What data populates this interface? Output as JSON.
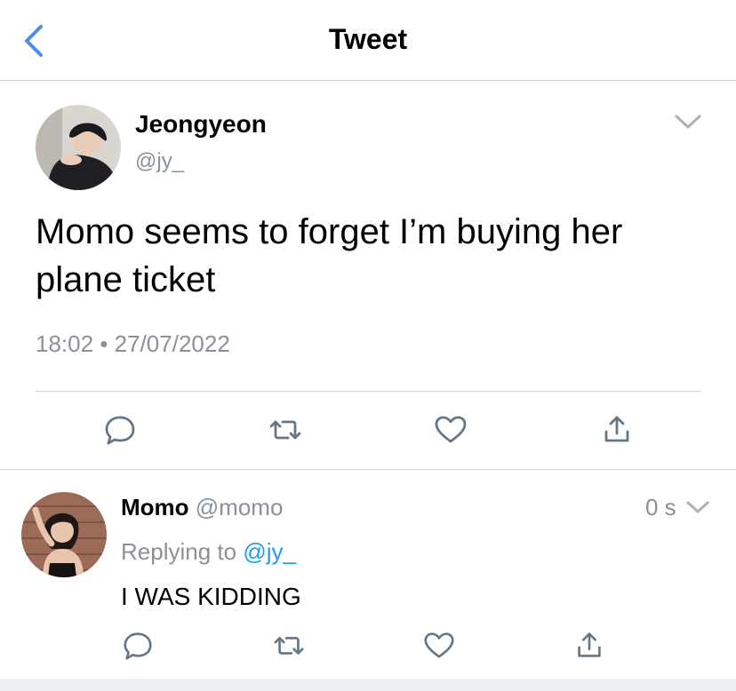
{
  "header": {
    "title": "Tweet"
  },
  "tweet": {
    "author_name": "Jeongyeon",
    "author_handle": "@jy_",
    "text": "Momo seems to forget I’m buying her plane ticket",
    "time": "18:02",
    "separator": "•",
    "date": "27/07/2022"
  },
  "reply": {
    "author_name": "Momo",
    "author_handle": "@momo",
    "age": "0 s",
    "replying_prefix": "Replying to",
    "replying_handle": "@jy_",
    "text": "I WAS KIDDING"
  },
  "icons": {
    "back": "chevron-left-icon",
    "more": "chevron-down-icon",
    "reply": "comment-icon",
    "retweet": "retweet-icon",
    "like": "heart-icon",
    "share": "share-icon"
  },
  "colors": {
    "accent": "#1d9bf0",
    "back_icon": "#4a90e2",
    "muted": "#8a9199",
    "icon": "#657786",
    "divider": "#cfd4d9"
  }
}
